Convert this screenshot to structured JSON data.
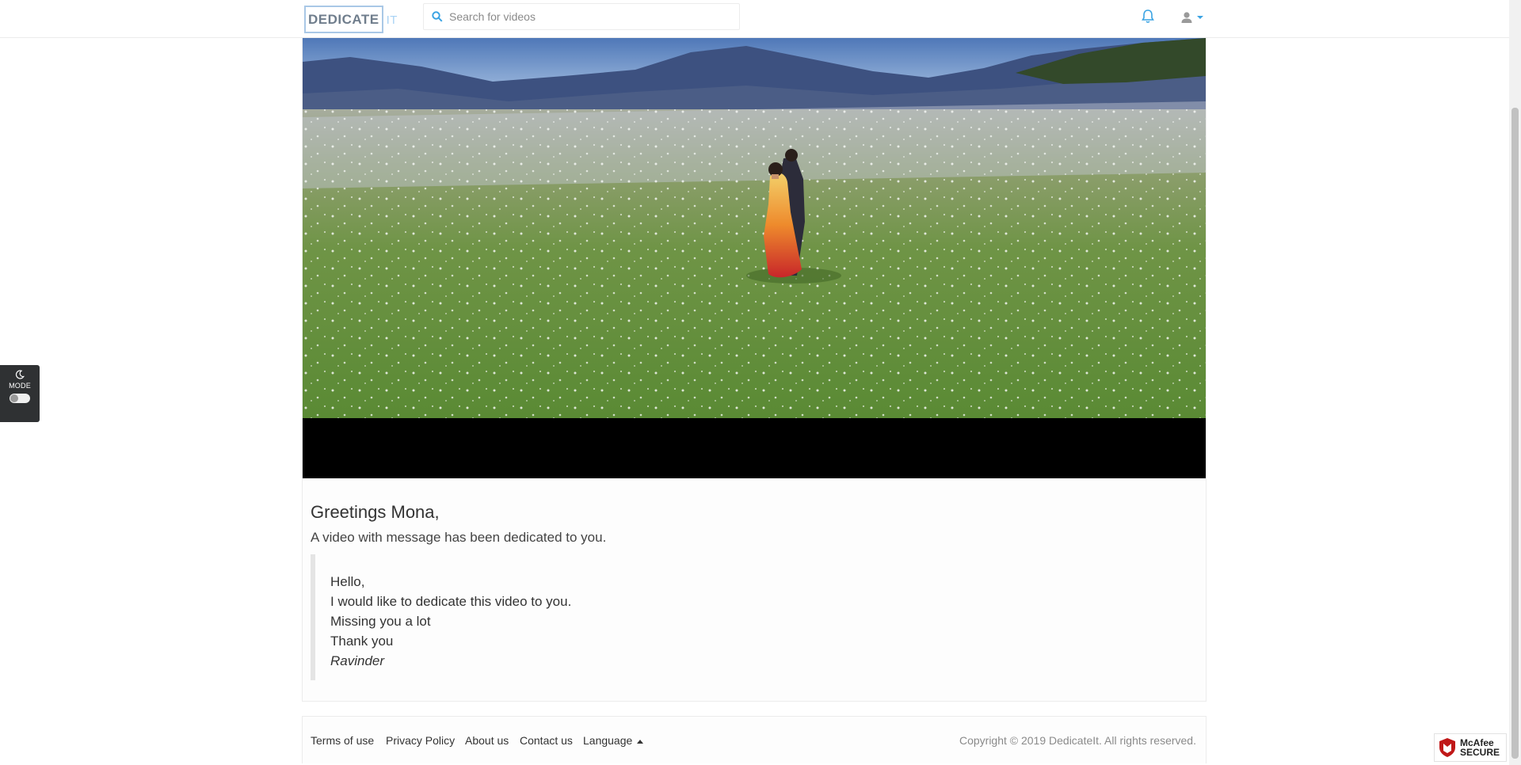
{
  "header": {
    "logo_main": "DEDICATE",
    "logo_suffix": "IT",
    "search_placeholder": "Search for videos",
    "search_value": ""
  },
  "mode_toggle": {
    "label": "MODE",
    "enabled": false
  },
  "video": {
    "player": "video-player"
  },
  "message": {
    "greeting": "Greetings Mona,",
    "subtitle": "A video with message has been dedicated to you.",
    "lines": [
      "Hello,",
      "I would like to dedicate this video to you.",
      "Missing you a lot",
      "Thank you"
    ],
    "signature": "Ravinder"
  },
  "footer": {
    "links": [
      "Terms of use",
      "Privacy Policy",
      "About us",
      "Contact us"
    ],
    "language_label": "Language",
    "copyright": "Copyright © 2019 DedicateIt. All rights reserved."
  },
  "badge": {
    "line1": "McAfee",
    "line2": "SECURE"
  },
  "colors": {
    "accent": "#3aa3e3",
    "logo_border": "#a9c8e6",
    "video_bg": "#000000"
  }
}
